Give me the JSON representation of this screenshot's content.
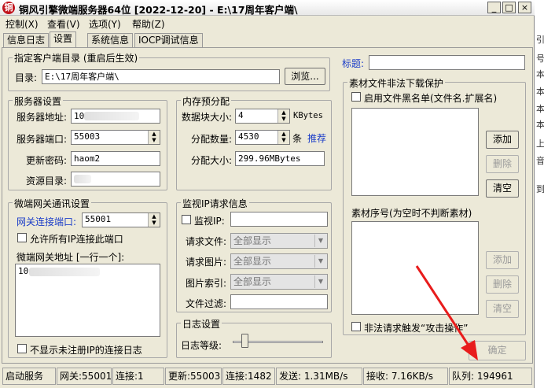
{
  "window": {
    "icon": "铜",
    "title": "铜风引擎微端服务器64位 [2022-12-20] - E:\\17周年客户端\\",
    "min_glyph": "_",
    "max_glyph": "□",
    "close_glyph": "×"
  },
  "menu": [
    "控制(X)",
    "查看(V)",
    "选项(Y)",
    "帮助(Z)"
  ],
  "tabs": [
    "信息日志",
    "设置",
    "系统信息",
    "IOCP调试信息"
  ],
  "client_dir": {
    "title": "指定客户端目录 (重启后生效)",
    "label": "目录:",
    "value": "E:\\17周年客户端\\",
    "browse": "浏览..."
  },
  "title_field": {
    "label": "标题:",
    "value": ""
  },
  "server": {
    "title": "服务器设置",
    "addr_label": "服务器地址:",
    "addr_value": "10",
    "port_label": "服务器端口:",
    "port_value": "55003",
    "pwd_label": "更新密码:",
    "pwd_value": "haom2",
    "res_label": "资源目录:"
  },
  "memory": {
    "title": "内存预分配",
    "block_label": "数据块大小:",
    "block_value": "4",
    "block_unit": "KBytes",
    "count_label": "分配数量:",
    "count_value": "4530",
    "count_unit": "条",
    "recommend": "推荐",
    "size_label": "分配大小:",
    "size_value": "299.96MBytes"
  },
  "gateway": {
    "title": "微端网关通讯设置",
    "port_label": "网关连接端口:",
    "port_value": "55001",
    "allow_all": "允许所有IP连接此端口",
    "addr_label": "微端网关地址 [一行一个]:",
    "addr_value": "10",
    "hide_log": "不显示未注册IP的连接日志"
  },
  "monitor": {
    "title": "监视IP请求信息",
    "ip_label": "监视IP:",
    "file_label": "请求文件:",
    "image_label": "请求图片:",
    "index_label": "图片索引:",
    "filter_label": "文件过滤:",
    "combo_value": "全部显示"
  },
  "log": {
    "title": "日志设置",
    "level_label": "日志等级:"
  },
  "protect": {
    "title": "素材文件非法下载保护",
    "blacklist": "启用文件黑名单(文件名.扩展名)",
    "add": "添加",
    "delete": "删除",
    "clear": "清空",
    "seq_label": "素材序号(为空时不判断素材)",
    "attack": "非法请求触发“攻击操作”",
    "ok": "确定"
  },
  "status": {
    "start": "启动服务",
    "gateway": "网关:55001",
    "conn1": "连接:1",
    "update": "更新:55003",
    "conn2": "连接:1482",
    "send": "发送: 1.31MB/s",
    "recv": "接收: 7.16KB/s",
    "queue": "队列: 194961"
  },
  "side_text": [
    "引",
    "号",
    "本",
    "本",
    "本",
    "本",
    "上",
    "音",
    "到"
  ],
  "colors": {
    "accent_blue": "#1a3cc8",
    "annotation_red": "#e81c1c"
  }
}
